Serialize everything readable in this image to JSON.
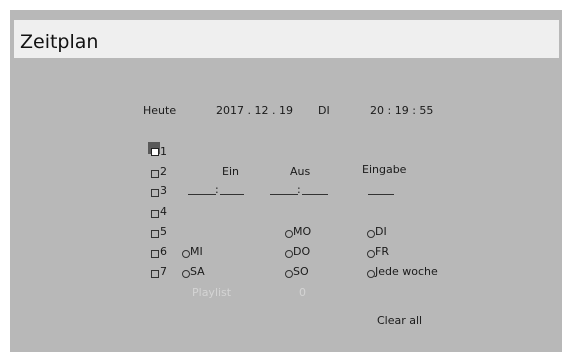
{
  "window": {
    "title": "Zeitplan"
  },
  "today": {
    "label": "Heute",
    "date": "2017 . 12 . 19",
    "weekday": "DI",
    "time": "20 : 19 : 55"
  },
  "slots": [
    "1",
    "2",
    "3",
    "4",
    "5",
    "6",
    "7"
  ],
  "headers": {
    "on": "Ein",
    "off": "Aus",
    "input": "Eingabe"
  },
  "time_separator": ":",
  "days": {
    "mo": "MO",
    "di": "DI",
    "mi": "MI",
    "do": "DO",
    "fr": "FR",
    "sa": "SA",
    "so": "SO",
    "weekly": "Jede woche"
  },
  "playlist": {
    "label": "Playlist",
    "value": "0"
  },
  "clear_all": "Clear all"
}
